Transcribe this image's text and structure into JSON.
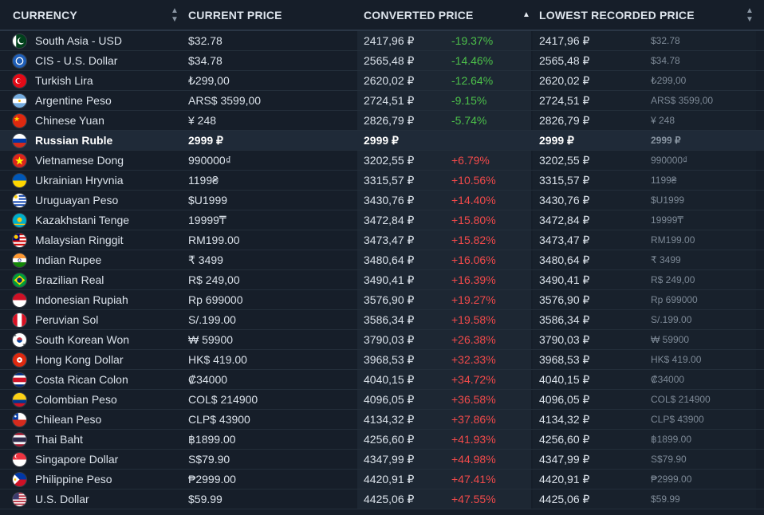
{
  "header": {
    "currency": "CURRENCY",
    "current_price": "CURRENT PRICE",
    "converted_price": "CONVERTED PRICE",
    "lowest_recorded_price": "LOWEST RECORDED PRICE"
  },
  "colors": {
    "background": "#161e29",
    "negative_diff": "#4cc04a",
    "positive_diff": "#f34a4a",
    "highlight_row": "#1f2a38"
  },
  "rows": [
    {
      "currency": "South Asia - USD",
      "flag": "pakistan-flag-icon",
      "price": "$32.78",
      "converted": "2417,96 ₽",
      "diff": "-19.37%",
      "lowest": "2417,96 ₽",
      "lowest_orig": "$32.78"
    },
    {
      "currency": "CIS - U.S. Dollar",
      "flag": "cis-flag-icon",
      "price": "$34.78",
      "converted": "2565,48 ₽",
      "diff": "-14.46%",
      "lowest": "2565,48 ₽",
      "lowest_orig": "$34.78"
    },
    {
      "currency": "Turkish Lira",
      "flag": "turkey-flag-icon",
      "price": "₺299,00",
      "converted": "2620,02 ₽",
      "diff": "-12.64%",
      "lowest": "2620,02 ₽",
      "lowest_orig": "₺299,00"
    },
    {
      "currency": "Argentine Peso",
      "flag": "argentina-flag-icon",
      "price": "ARS$ 3599,00",
      "converted": "2724,51 ₽",
      "diff": "-9.15%",
      "lowest": "2724,51 ₽",
      "lowest_orig": "ARS$ 3599,00"
    },
    {
      "currency": "Chinese Yuan",
      "flag": "china-flag-icon",
      "price": "¥ 248",
      "converted": "2826,79 ₽",
      "diff": "-5.74%",
      "lowest": "2826,79 ₽",
      "lowest_orig": "¥ 248"
    },
    {
      "currency": "Russian Ruble",
      "flag": "russia-flag-icon",
      "price": "2999 ₽",
      "converted": "2999 ₽",
      "diff": "",
      "lowest": "2999 ₽",
      "lowest_orig": "2999 ₽"
    },
    {
      "currency": "Vietnamese Dong",
      "flag": "vietnam-flag-icon",
      "price": "990000₫",
      "converted": "3202,55 ₽",
      "diff": "+6.79%",
      "lowest": "3202,55 ₽",
      "lowest_orig": "990000₫"
    },
    {
      "currency": "Ukrainian Hryvnia",
      "flag": "ukraine-flag-icon",
      "price": "1199₴",
      "converted": "3315,57 ₽",
      "diff": "+10.56%",
      "lowest": "3315,57 ₽",
      "lowest_orig": "1199₴"
    },
    {
      "currency": "Uruguayan Peso",
      "flag": "uruguay-flag-icon",
      "price": "$U1999",
      "converted": "3430,76 ₽",
      "diff": "+14.40%",
      "lowest": "3430,76 ₽",
      "lowest_orig": "$U1999"
    },
    {
      "currency": "Kazakhstani Tenge",
      "flag": "kazakhstan-flag-icon",
      "price": "19999₸",
      "converted": "3472,84 ₽",
      "diff": "+15.80%",
      "lowest": "3472,84 ₽",
      "lowest_orig": "19999₸"
    },
    {
      "currency": "Malaysian Ringgit",
      "flag": "malaysia-flag-icon",
      "price": "RM199.00",
      "converted": "3473,47 ₽",
      "diff": "+15.82%",
      "lowest": "3473,47 ₽",
      "lowest_orig": "RM199.00"
    },
    {
      "currency": "Indian Rupee",
      "flag": "india-flag-icon",
      "price": "₹ 3499",
      "converted": "3480,64 ₽",
      "diff": "+16.06%",
      "lowest": "3480,64 ₽",
      "lowest_orig": "₹ 3499"
    },
    {
      "currency": "Brazilian Real",
      "flag": "brazil-flag-icon",
      "price": "R$ 249,00",
      "converted": "3490,41 ₽",
      "diff": "+16.39%",
      "lowest": "3490,41 ₽",
      "lowest_orig": "R$ 249,00"
    },
    {
      "currency": "Indonesian Rupiah",
      "flag": "indonesia-flag-icon",
      "price": "Rp 699000",
      "converted": "3576,90 ₽",
      "diff": "+19.27%",
      "lowest": "3576,90 ₽",
      "lowest_orig": "Rp 699000"
    },
    {
      "currency": "Peruvian Sol",
      "flag": "peru-flag-icon",
      "price": "S/.199.00",
      "converted": "3586,34 ₽",
      "diff": "+19.58%",
      "lowest": "3586,34 ₽",
      "lowest_orig": "S/.199.00"
    },
    {
      "currency": "South Korean Won",
      "flag": "south-korea-flag-icon",
      "price": "₩ 59900",
      "converted": "3790,03 ₽",
      "diff": "+26.38%",
      "lowest": "3790,03 ₽",
      "lowest_orig": "₩ 59900"
    },
    {
      "currency": "Hong Kong Dollar",
      "flag": "hong-kong-flag-icon",
      "price": "HK$ 419.00",
      "converted": "3968,53 ₽",
      "diff": "+32.33%",
      "lowest": "3968,53 ₽",
      "lowest_orig": "HK$ 419.00"
    },
    {
      "currency": "Costa Rican Colon",
      "flag": "costa-rica-flag-icon",
      "price": "₡34000",
      "converted": "4040,15 ₽",
      "diff": "+34.72%",
      "lowest": "4040,15 ₽",
      "lowest_orig": "₡34000"
    },
    {
      "currency": "Colombian Peso",
      "flag": "colombia-flag-icon",
      "price": "COL$ 214900",
      "converted": "4096,05 ₽",
      "diff": "+36.58%",
      "lowest": "4096,05 ₽",
      "lowest_orig": "COL$ 214900"
    },
    {
      "currency": "Chilean Peso",
      "flag": "chile-flag-icon",
      "price": "CLP$ 43900",
      "converted": "4134,32 ₽",
      "diff": "+37.86%",
      "lowest": "4134,32 ₽",
      "lowest_orig": "CLP$ 43900"
    },
    {
      "currency": "Thai Baht",
      "flag": "thailand-flag-icon",
      "price": "฿1899.00",
      "converted": "4256,60 ₽",
      "diff": "+41.93%",
      "lowest": "4256,60 ₽",
      "lowest_orig": "฿1899.00"
    },
    {
      "currency": "Singapore Dollar",
      "flag": "singapore-flag-icon",
      "price": "S$79.90",
      "converted": "4347,99 ₽",
      "diff": "+44.98%",
      "lowest": "4347,99 ₽",
      "lowest_orig": "S$79.90"
    },
    {
      "currency": "Philippine Peso",
      "flag": "philippines-flag-icon",
      "price": "₱2999.00",
      "converted": "4420,91 ₽",
      "diff": "+47.41%",
      "lowest": "4420,91 ₽",
      "lowest_orig": "₱2999.00"
    },
    {
      "currency": "U.S. Dollar",
      "flag": "usa-flag-icon",
      "price": "$59.99",
      "converted": "4425,06 ₽",
      "diff": "+47.55%",
      "lowest": "4425,06 ₽",
      "lowest_orig": "$59.99"
    }
  ]
}
